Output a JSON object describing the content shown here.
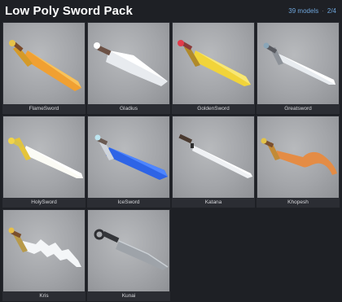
{
  "header": {
    "title": "Low Poly Sword Pack",
    "model_count": "39 models",
    "page": "2/4"
  },
  "items": [
    {
      "label": "FlameSword"
    },
    {
      "label": "Gladius"
    },
    {
      "label": "GoldenSword"
    },
    {
      "label": "Greatsword"
    },
    {
      "label": "HolySword"
    },
    {
      "label": "IceSword"
    },
    {
      "label": "Katana"
    },
    {
      "label": "Khopesh"
    },
    {
      "label": "Kris"
    },
    {
      "label": "Kunai"
    }
  ]
}
